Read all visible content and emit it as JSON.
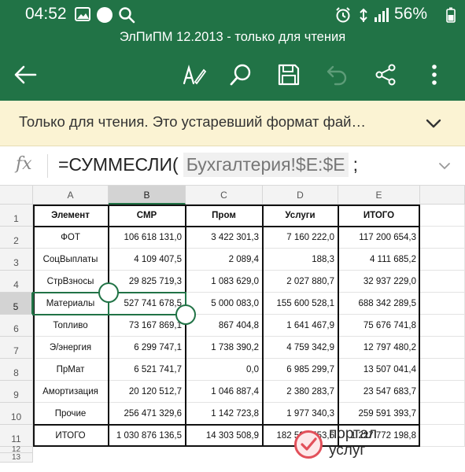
{
  "status": {
    "time": "04:52",
    "battery_pct": "56%",
    "icons": [
      "gallery-icon",
      "dub-icon",
      "search-icon",
      "alarm-icon",
      "wifi-icon",
      "signal-icon",
      "battery-icon"
    ],
    "dub_label": "dub"
  },
  "title": "ЭлПиПМ 12.2013 - только для чтения",
  "toolbar": {
    "icons": [
      "back-arrow-icon",
      "edit-pen-icon",
      "search-icon",
      "save-icon",
      "undo-icon",
      "share-icon",
      "more-icon"
    ]
  },
  "banner": {
    "message": "Только для чтения. Это устаревший формат фай…"
  },
  "formula": {
    "fx": "fx",
    "prefix": "=СУММЕСЛИ(",
    "ref": "Бухгалтерия!$E:$E",
    "suffix": ";"
  },
  "sheet": {
    "columns": [
      "A",
      "B",
      "C",
      "D",
      "E"
    ],
    "rows": [
      "1",
      "2",
      "3",
      "4",
      "5",
      "6",
      "7",
      "8",
      "9",
      "10",
      "11",
      "12",
      "13"
    ],
    "headers": [
      "Элемент",
      "СМР",
      "Пром",
      "Услуги",
      "ИТОГО"
    ],
    "data": [
      [
        "ФОТ",
        "106 618 131,0",
        "3 422 301,3",
        "7 160 222,0",
        "117 200 654,3"
      ],
      [
        "СоцВыплаты",
        "4 109 407,5",
        "2 089,4",
        "188,3",
        "4 111 685,2"
      ],
      [
        "СтрВзносы",
        "29 825 719,3",
        "1 083 629,0",
        "2 027 880,7",
        "32 937 229,0"
      ],
      [
        "Материалы",
        "527 741 678,5",
        "5 000 083,0",
        "155 600 528,1",
        "688 342 289,5"
      ],
      [
        "Топливо",
        "73 167 869,1",
        "867 404,8",
        "1 641 467,9",
        "75 676 741,8"
      ],
      [
        "Э/энергия",
        "6 299 747,1",
        "1 738 390,2",
        "4 759 342,9",
        "12 797 480,2"
      ],
      [
        "ПрМат",
        "6 521 741,7",
        "0,0",
        "6 985 299,7",
        "13 507 041,4"
      ],
      [
        "Амортизация",
        "20 120 512,7",
        "1 046 887,4",
        "2 380 283,7",
        "23 547 683,7"
      ],
      [
        "Прочие",
        "256 471 329,6",
        "1 142 723,8",
        "1 977 340,3",
        "259 591 393,7"
      ],
      [
        "ИТОГО",
        "1 030 876 136,5",
        "14 303 508,9",
        "182 591 553,6",
        "1 227 772 198,8"
      ]
    ],
    "selected_cell": "B5"
  },
  "watermark": {
    "line1": "портал",
    "line2": "услуг"
  },
  "colors": {
    "excel_green": "#217346",
    "banner_bg": "#fbf3d3",
    "watermark_red": "#e2505a"
  }
}
